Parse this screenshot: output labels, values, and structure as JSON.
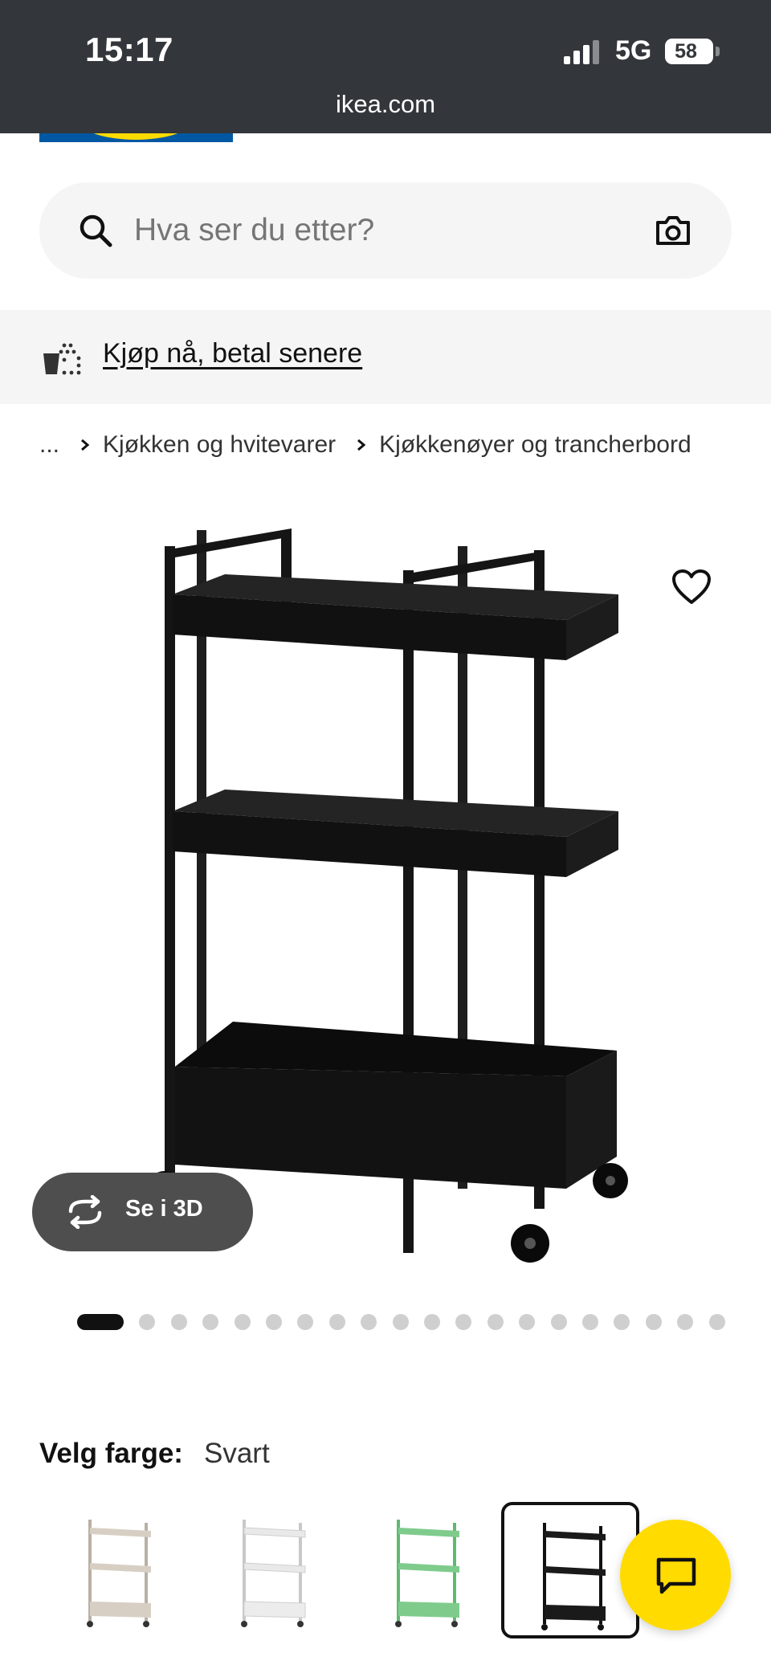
{
  "status_bar": {
    "time": "15:17",
    "network": "5G",
    "battery": "58",
    "url": "ikea.com"
  },
  "search": {
    "placeholder": "Hva ser du etter?"
  },
  "banner": {
    "link": "Kjøp nå, betal senere"
  },
  "breadcrumb": {
    "ellipsis": "...",
    "items": [
      "Kjøkken og hvitevarer",
      "Kjøkkenøyer og trancherbord"
    ]
  },
  "gallery": {
    "view_3d_label": "Se i 3D",
    "image_count": 20,
    "active_index": 0
  },
  "color": {
    "label": "Velg farge:",
    "value": "Svart",
    "options": [
      {
        "name": "beige",
        "color": "#d8cfc4"
      },
      {
        "name": "white",
        "color": "#f2f2f2"
      },
      {
        "name": "green",
        "color": "#8fd49b"
      },
      {
        "name": "black",
        "color": "#1a1a1a",
        "selected": true
      }
    ]
  },
  "colors": {
    "status_bar_bg": "#33363a",
    "accent_yellow": "#ffdb00",
    "brand_blue": "#0058a3"
  }
}
